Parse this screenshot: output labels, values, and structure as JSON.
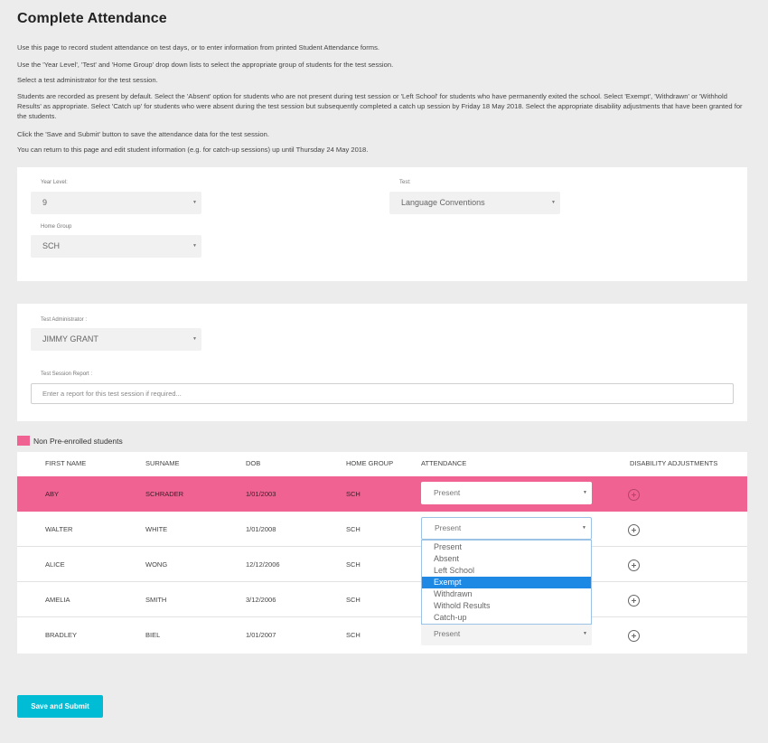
{
  "page_title": "Complete Attendance",
  "instructions": [
    "Use this page to record student attendance on test days, or to enter information from printed Student Attendance forms.",
    "Use the 'Year Level', 'Test' and 'Home Group' drop down lists to select the appropriate group of students for the test session.",
    "Select a test administrator for the test session.",
    "Students are recorded as present by default. Select the 'Absent' option for students who are not present during test session or 'Left School' for students who have permanently exited the school. Select 'Exempt', 'Withdrawn' or 'Withhold Results' as appropriate. Select 'Catch up' for students who were absent during the test session but subsequently completed a catch up session by Friday 18 May 2018. Select the appropriate disability adjustments that have been granted for the students.",
    "Click the 'Save and Submit' button to save the attendance data for the test session.",
    "You can return to this page and edit student information (e.g. for catch-up sessions) up until Thursday 24 May 2018."
  ],
  "filters": {
    "year_level_label": "Year Level:",
    "year_level_value": "9",
    "test_label": "Test:",
    "test_value": "Language Conventions",
    "home_group_label": "Home Group",
    "home_group_value": "SCH"
  },
  "session": {
    "administrator_label": "Test Administrator :",
    "administrator_value": "JIMMY GRANT",
    "report_label": "Test Session Report :",
    "report_placeholder": "Enter a report for this test session if required..."
  },
  "legend": {
    "label": "Non Pre-enrolled students",
    "color": "#f06292"
  },
  "table": {
    "headers": [
      "FIRST NAME",
      "SURNAME",
      "DOB",
      "HOME GROUP",
      "ATTENDANCE",
      "DISABILITY ADJUSTMENTS"
    ],
    "rows": [
      {
        "first": "ABY",
        "surname": "SCHRADER",
        "dob": "1/01/2003",
        "group": "SCH",
        "attendance": "Present",
        "non_pre_enrolled": true
      },
      {
        "first": "WALTER",
        "surname": "WHITE",
        "dob": "1/01/2008",
        "group": "SCH",
        "attendance": "Present",
        "non_pre_enrolled": false
      },
      {
        "first": "ALICE",
        "surname": "WONG",
        "dob": "12/12/2006",
        "group": "SCH",
        "attendance": "",
        "non_pre_enrolled": false
      },
      {
        "first": "AMELIA",
        "surname": "SMITH",
        "dob": "3/12/2006",
        "group": "SCH",
        "attendance": "",
        "non_pre_enrolled": false
      },
      {
        "first": "BRADLEY",
        "surname": "BIEL",
        "dob": "1/01/2007",
        "group": "SCH",
        "attendance": "Present",
        "non_pre_enrolled": false
      }
    ]
  },
  "attendance_dropdown": {
    "options": [
      "Present",
      "Absent",
      "Left School",
      "Exempt",
      "Withdrawn",
      "Withold Results",
      "Catch-up"
    ],
    "highlighted": "Exempt"
  },
  "submit_label": "Save and Submit",
  "colors": {
    "accent": "#00bcd4",
    "highlight": "#1e88e5",
    "non_pre_enrolled": "#f06292"
  }
}
